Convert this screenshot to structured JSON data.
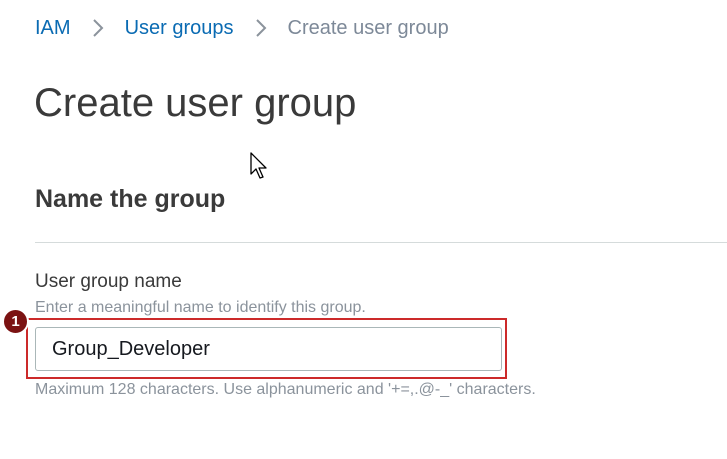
{
  "breadcrumb": {
    "items": [
      {
        "label": "IAM"
      },
      {
        "label": "User groups"
      },
      {
        "label": "Create user group"
      }
    ]
  },
  "page": {
    "title": "Create user group"
  },
  "section": {
    "title": "Name the group"
  },
  "field": {
    "label": "User group name",
    "description": "Enter a meaningful name to identify this group.",
    "value": "Group_Developer",
    "constraint": "Maximum 128 characters. Use alphanumeric and '+=,.@-_' characters."
  },
  "annotation": {
    "step_number": "1"
  },
  "colors": {
    "link": "#0a6bb3",
    "current_crumb": "#7d8998",
    "highlight": "#cc2a2a",
    "badge": "#7b1212"
  },
  "icons": {
    "separator": "chevron-right-icon",
    "cursor": "mouse-pointer-icon"
  }
}
